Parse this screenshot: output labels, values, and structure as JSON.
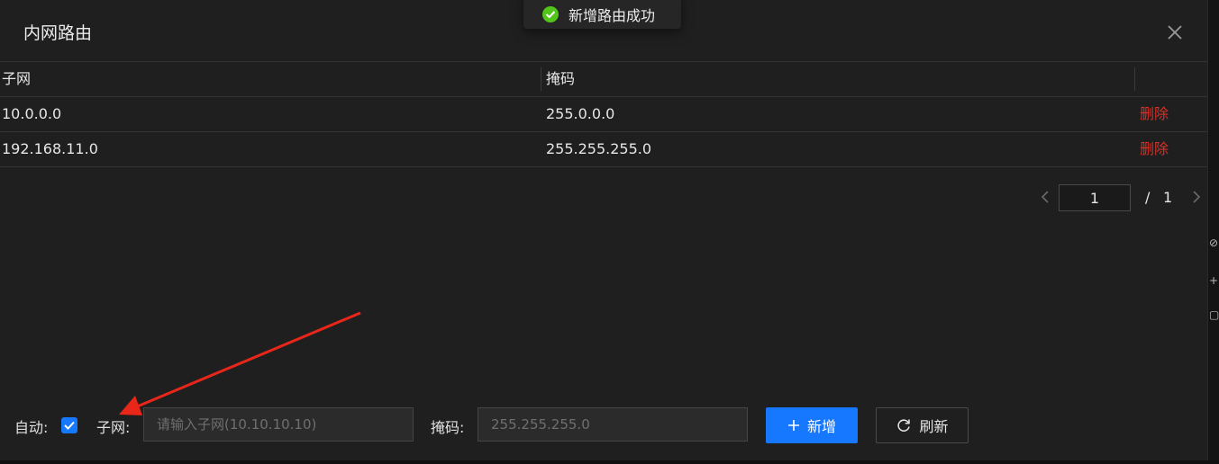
{
  "modal": {
    "title": "内网路由",
    "close_icon": "close-icon"
  },
  "toast": {
    "message": "新增路由成功",
    "icon": "check-circle-icon",
    "icon_color": "#52c41a"
  },
  "table": {
    "columns": [
      "子网",
      "掩码",
      ""
    ],
    "rows": [
      {
        "subnet": "10.0.0.0",
        "mask": "255.0.0.0",
        "action": "删除"
      },
      {
        "subnet": "192.168.11.0",
        "mask": "255.255.255.0",
        "action": "删除"
      }
    ]
  },
  "pagination": {
    "current": "1",
    "slash": "/",
    "total": "1"
  },
  "form": {
    "auto_label": "自动:",
    "auto_checked": true,
    "subnet_label": "子网:",
    "subnet_placeholder": "请输入子网(10.10.10.10)",
    "mask_label": "掩码:",
    "mask_placeholder": "255.255.255.0",
    "add_label": "新增",
    "refresh_label": "刷新"
  },
  "colors": {
    "accent": "#1677ff",
    "danger": "#d93026",
    "annotation_arrow": "#e8261a"
  }
}
